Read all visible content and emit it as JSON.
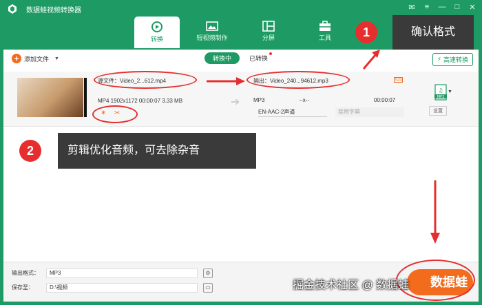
{
  "window": {
    "title": "数据蛙视频转换器"
  },
  "tabs": [
    {
      "label": "转换",
      "icon": "convert-icon",
      "active": true
    },
    {
      "label": "短视频制作",
      "icon": "shortvideo-icon",
      "active": false
    },
    {
      "label": "分屏",
      "icon": "split-icon",
      "active": false
    },
    {
      "label": "工具",
      "icon": "toolbox-icon",
      "active": false
    }
  ],
  "toolbar": {
    "add_file": "添加文件",
    "converting": "转换中",
    "converted": "已转换",
    "fast_convert": "高速转换"
  },
  "file": {
    "source_name": "源文件：Video_2...612.mp4",
    "meta": "MP4   1902x1172   00:00:07   3.33 MB",
    "output_name": "输出：Video_240...94612.mp3",
    "output_format": "MP3",
    "output_res": "--x--",
    "output_duration": "00:00:07",
    "audio_track": "EN-AAC-2声道",
    "subtitle": "禁用字幕",
    "format_badge": "MP3",
    "settings": "设置",
    "id3": "ID3"
  },
  "bottom": {
    "out_format_label": "输出格式：",
    "out_format_value": "MP3",
    "save_label": "保存至：",
    "save_value": "D:\\视频",
    "convert_all": "数据蛙"
  },
  "annotations": {
    "callout1_num": "1",
    "callout1_text": "确认格式",
    "callout2_num": "2",
    "callout2_text": "剪辑优化音频，可去除杂音"
  },
  "watermark": "掘金技术社区 @ 数据蛙",
  "colors": {
    "brand": "#1e9b64",
    "accent": "#f36b1c",
    "annot": "#e62e2e"
  }
}
